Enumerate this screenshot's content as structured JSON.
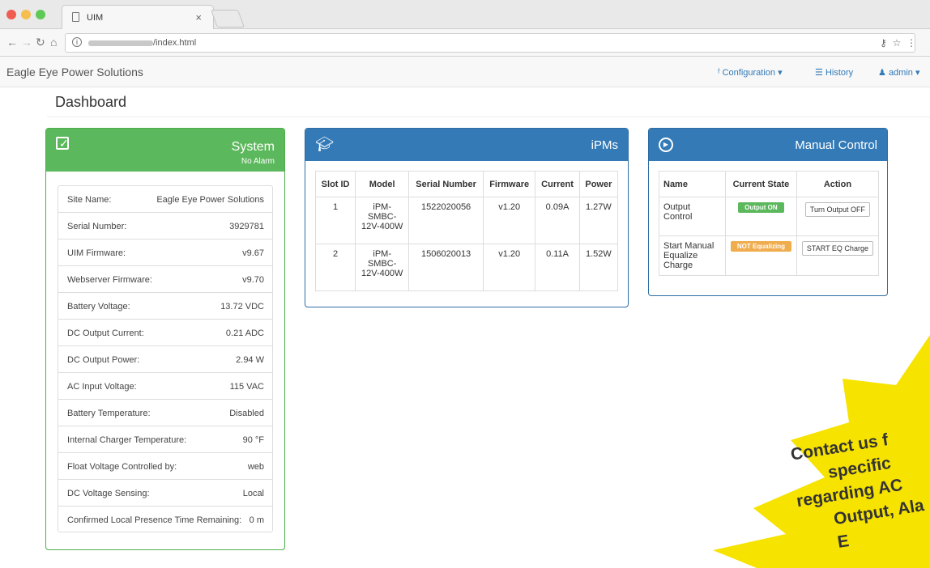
{
  "browser": {
    "tab_title": "UIM",
    "tab_close": "×",
    "url": "/index.html",
    "icons": {
      "back": "arrow-left",
      "forward": "arrow-right",
      "reload": "reload",
      "home": "home",
      "info": "info",
      "key": "key",
      "star": "star",
      "menu": "menu"
    }
  },
  "navbar": {
    "brand": "Eagle Eye Power Solutions",
    "configuration": "Configuration ▾",
    "history": "History",
    "admin": "admin ▾"
  },
  "page_title": "Dashboard",
  "system": {
    "title": "System",
    "subtitle": "No Alarm",
    "rows": [
      {
        "label": "Site Name:",
        "value": "Eagle Eye Power Solutions"
      },
      {
        "label": "Serial Number:",
        "value": "3929781"
      },
      {
        "label": "UIM Firmware:",
        "value": "v9.67"
      },
      {
        "label": "Webserver Firmware:",
        "value": "v9.70"
      },
      {
        "label": "Battery Voltage:",
        "value": "13.72 VDC"
      },
      {
        "label": "DC Output Current:",
        "value": "0.21 ADC"
      },
      {
        "label": "DC Output Power:",
        "value": "2.94 W"
      },
      {
        "label": "AC Input Voltage:",
        "value": "115 VAC"
      },
      {
        "label": "Battery Temperature:",
        "value": "Disabled"
      },
      {
        "label": "Internal Charger Temperature:",
        "value": "90 °F"
      },
      {
        "label": "Float Voltage Controlled by:",
        "value": "web"
      },
      {
        "label": "DC Voltage Sensing:",
        "value": "Local"
      },
      {
        "label": "Confirmed Local Presence Time Remaining:",
        "value": "0 m"
      }
    ]
  },
  "ipms": {
    "title": "iPMs",
    "headers": [
      "Slot ID",
      "Model",
      "Serial Number",
      "Firmware",
      "Current",
      "Power"
    ],
    "rows": [
      {
        "slot": "1",
        "model": "iPM-SMBC-12V-400W",
        "serial": "1522020056",
        "firmware": "v1.20",
        "current": "0.09A",
        "power": "1.27W"
      },
      {
        "slot": "2",
        "model": "iPM-SMBC-12V-400W",
        "serial": "1506020013",
        "firmware": "v1.20",
        "current": "0.11A",
        "power": "1.52W"
      }
    ]
  },
  "manual_control": {
    "title": "Manual Control",
    "headers": [
      "Name",
      "Current State",
      "Action"
    ],
    "rows": [
      {
        "name": "Output Control",
        "state": "Output ON",
        "action": "Turn Output OFF"
      },
      {
        "name": "Start Manual Equalize Charge",
        "state": "NOT Equalizing",
        "action": "START EQ Charge"
      }
    ]
  },
  "promo": {
    "lines": [
      "Contact us f",
      "specific",
      "regarding AC",
      "Output, Ala",
      "E"
    ]
  },
  "colors": {
    "success": "#5cb85c",
    "primary": "#337ab7",
    "warning": "#f0ad4e",
    "burst": "#f7e300"
  }
}
